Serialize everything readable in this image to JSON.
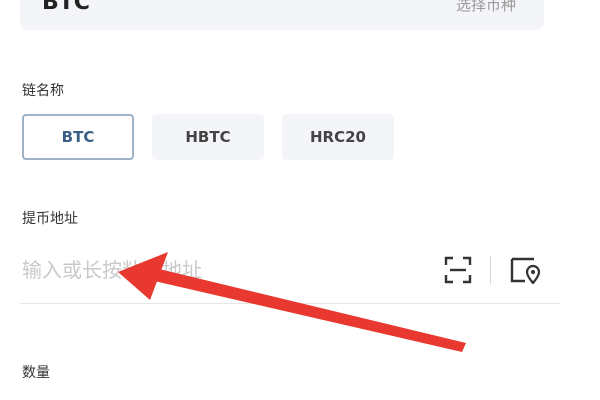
{
  "coin": {
    "name": "BTC",
    "switch_label": "选择币种"
  },
  "chain": {
    "label": "链名称",
    "options": [
      "BTC",
      "HBTC",
      "HRC20"
    ],
    "selected": "BTC"
  },
  "address": {
    "label": "提币地址",
    "placeholder": "输入或长按粘贴地址",
    "value": ""
  },
  "quantity": {
    "label": "数量"
  },
  "icons": {
    "scan": "scan-icon",
    "address_book": "address-book-icon",
    "annotation": "red-arrow-annotation"
  },
  "colors": {
    "selected_border": "#9fb2c6",
    "selected_text": "#3a5f86",
    "chip_bg": "#f4f5f8",
    "arrow": "#e8382f"
  }
}
